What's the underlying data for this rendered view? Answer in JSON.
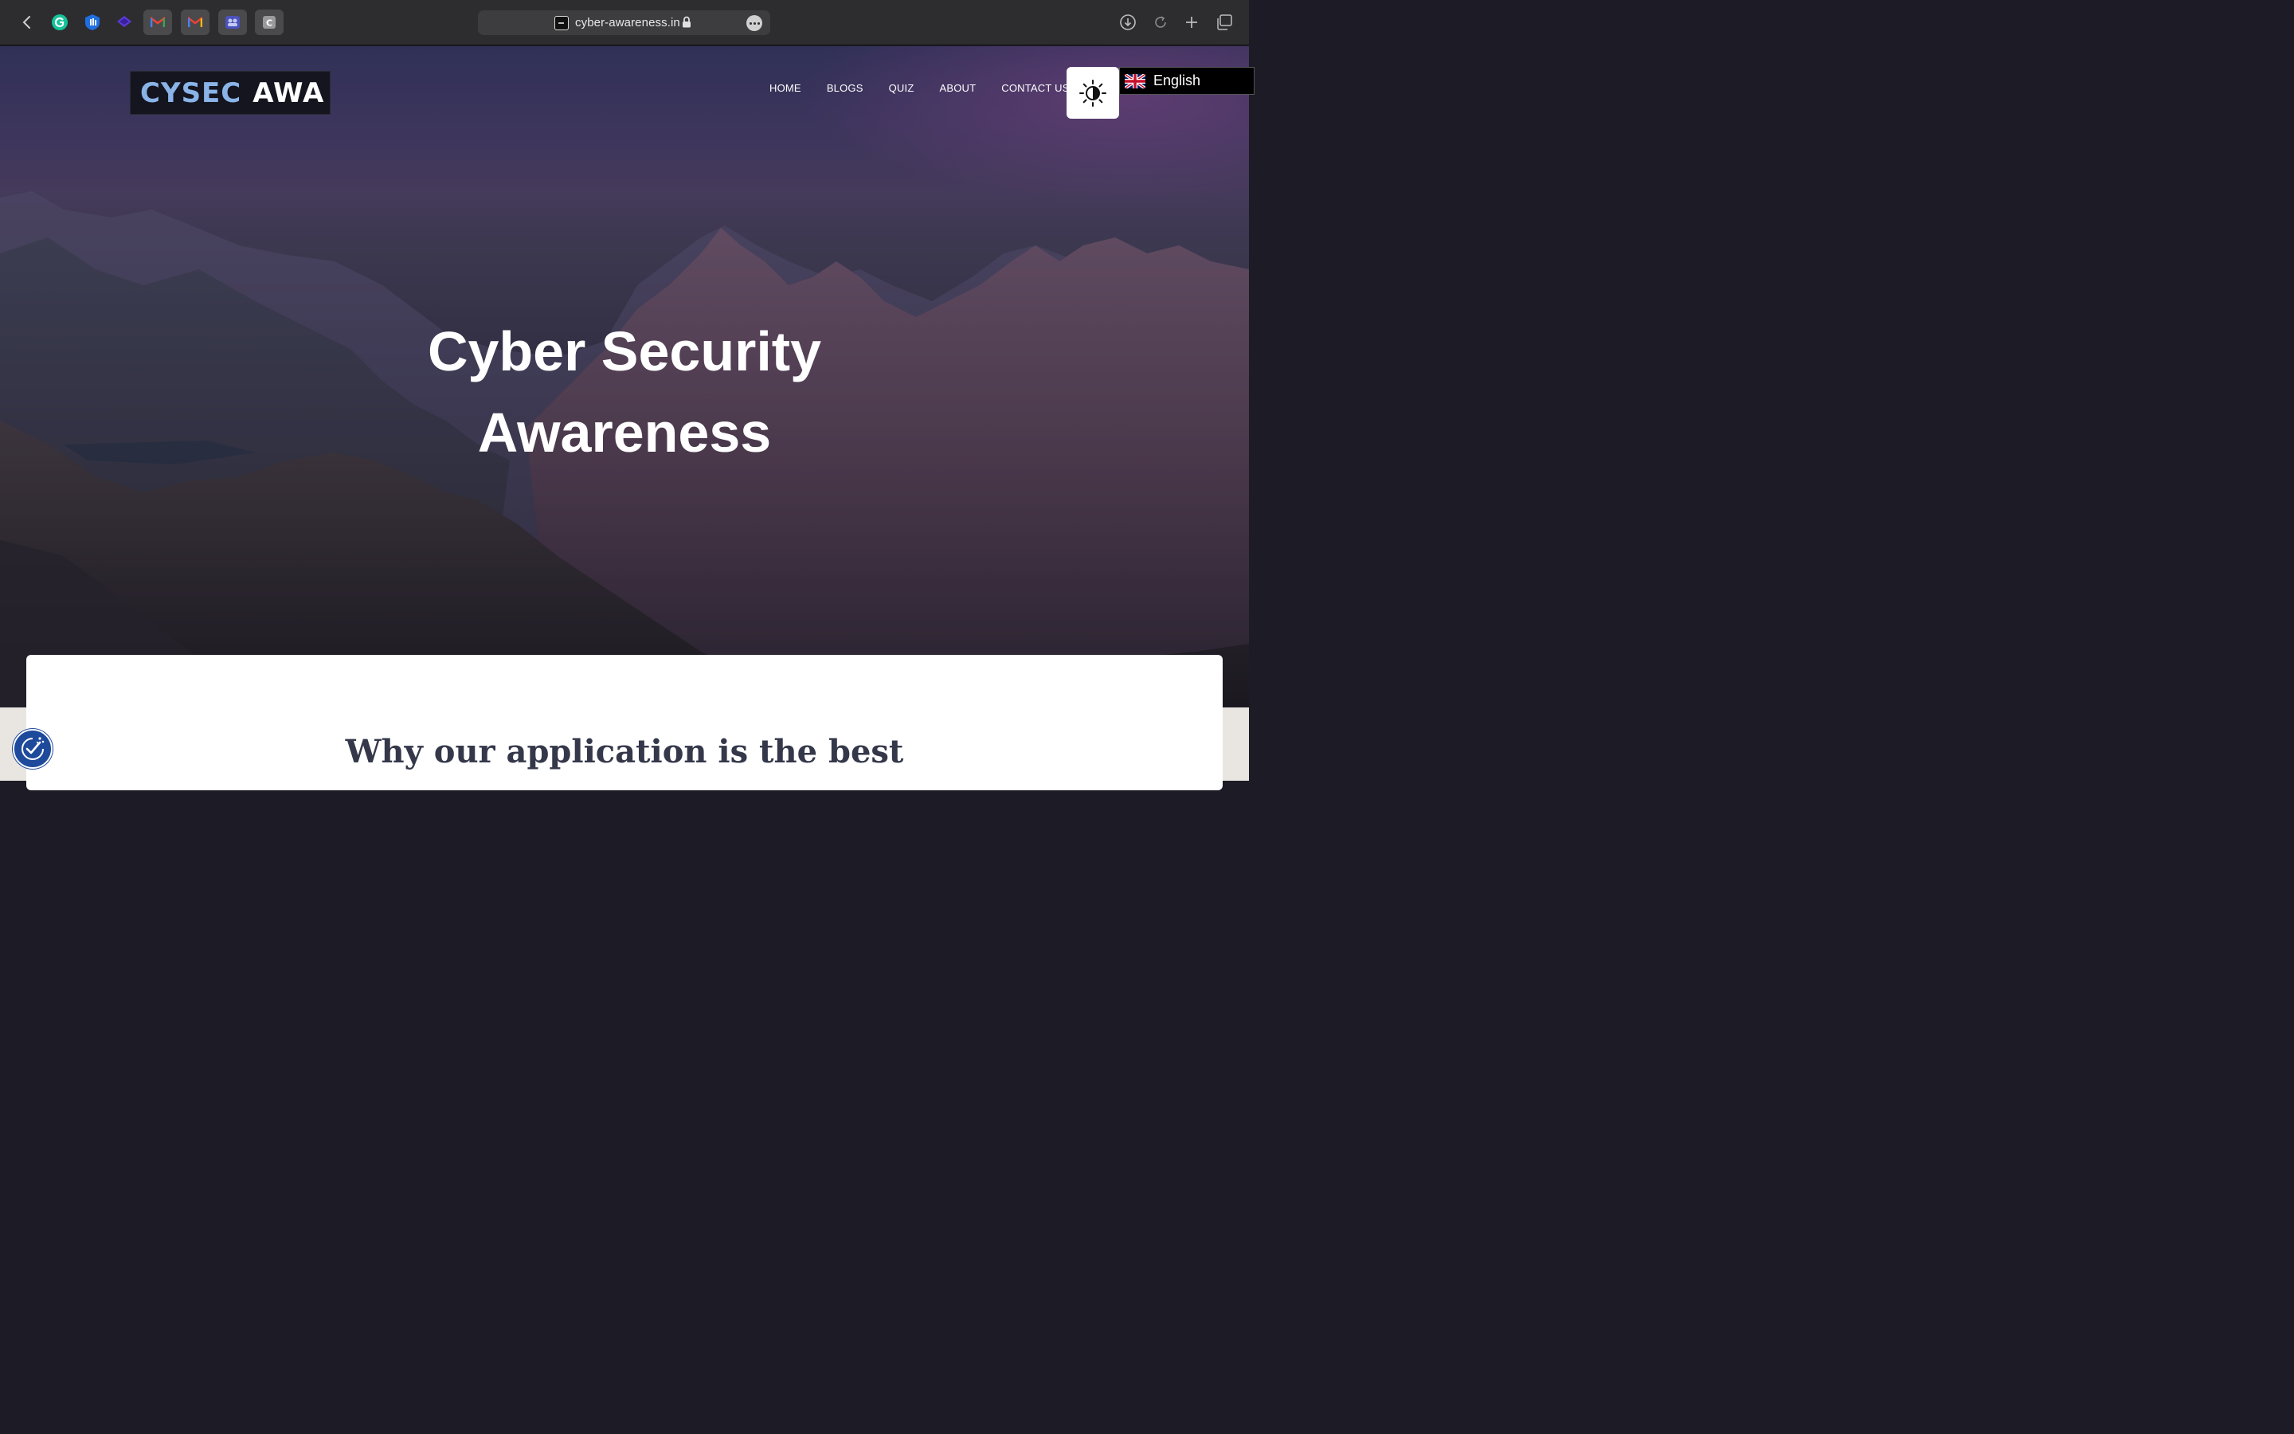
{
  "browser": {
    "url": "cyber-awareness.in",
    "tabs": [
      "grammarly-icon",
      "hand-icon",
      "stack-icon",
      "gmail-icon",
      "gmail-icon",
      "teams-icon",
      "c-icon"
    ]
  },
  "site": {
    "logo": {
      "part1": "CYSEC",
      "part2": "AWA"
    },
    "nav": [
      "HOME",
      "BLOGS",
      "QUIZ",
      "ABOUT",
      "CONTACT US"
    ],
    "language": "English",
    "hero_line1": "Cyber Security",
    "hero_line2": "Awareness",
    "section_title": "Why our application is the best"
  },
  "colors": {
    "logo_accent": "#8ab4e8",
    "a11y_button": "#1e4a9c",
    "section_title": "#34384a"
  }
}
